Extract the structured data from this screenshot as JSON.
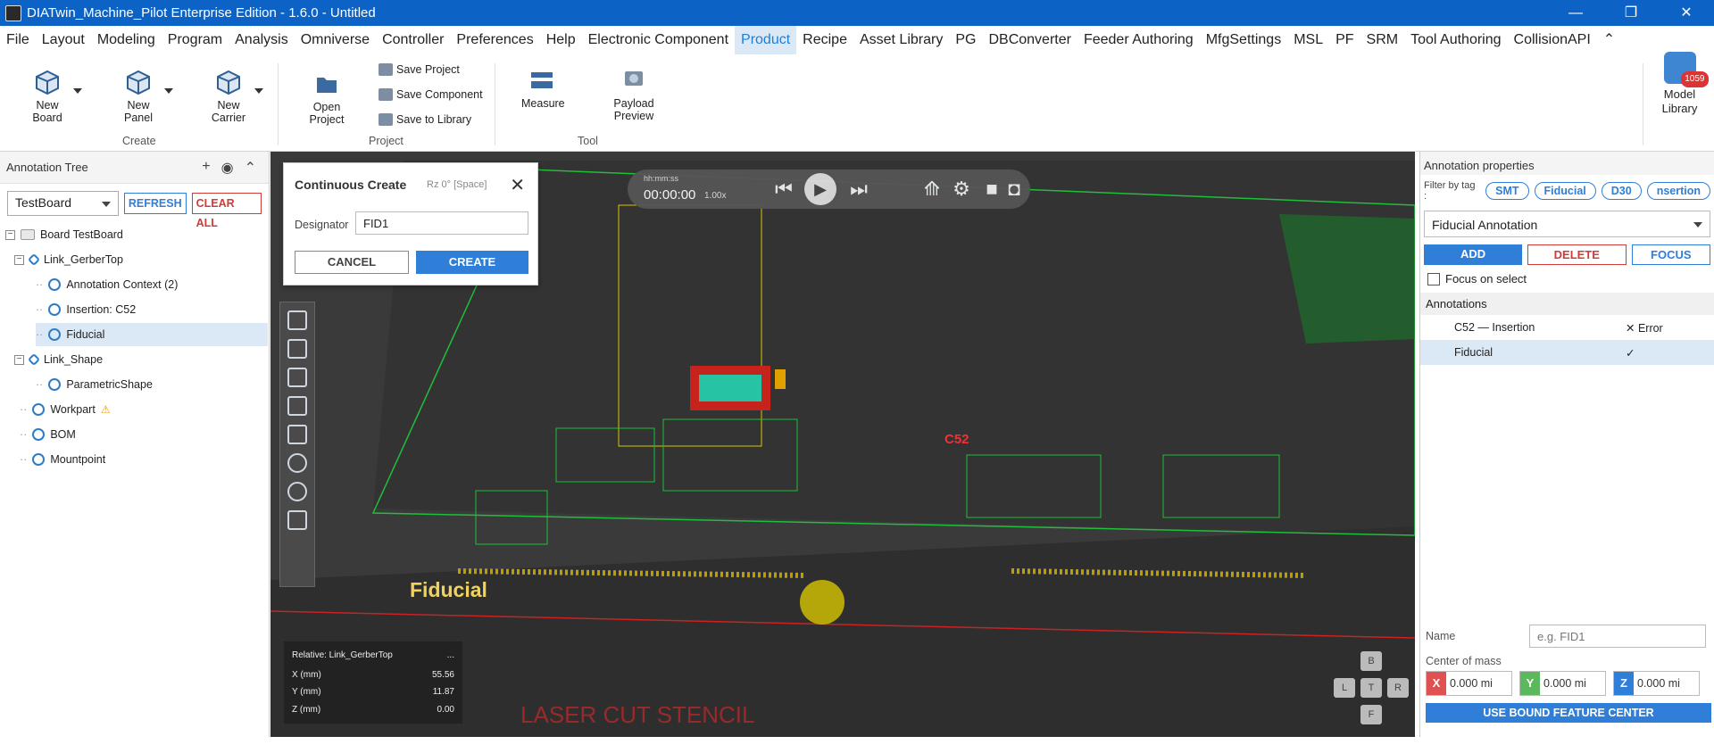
{
  "titlebar": {
    "title": "DIATwin_Machine_Pilot Enterprise Edition - 1.6.0 - Untitled",
    "min": "—",
    "max": "❐",
    "close": "✕"
  },
  "menu": [
    "File",
    "Layout",
    "Modeling",
    "Program",
    "Analysis",
    "Omniverse",
    "Controller",
    "Preferences",
    "Help",
    "Electronic Component",
    "Product",
    "Recipe",
    "Asset Library",
    "PG",
    "DBConverter",
    "Feeder Authoring",
    "MfgSettings",
    "MSL",
    "PF",
    "SRM",
    "Tool Authoring",
    "CollisionAPI"
  ],
  "menu_active": "Product",
  "ribbon": {
    "new_board": "New\nBoard",
    "new_panel": "New\nPanel",
    "new_carrier": "New\nCarrier",
    "group_create": "Create",
    "open_project": "Open\nProject",
    "save_project": "Save Project",
    "save_component": "Save Component",
    "save_library": "Save to Library",
    "group_project": "Project",
    "measure": "Measure",
    "payload_preview": "Payload\nPreview",
    "group_tool": "Tool",
    "model_library": "Model\nLibrary",
    "model_badge": "1059"
  },
  "annotation_tree": {
    "title": "Annotation Tree",
    "board_select": "TestBoard",
    "refresh": "REFRESH",
    "clear_all": "CLEAR ALL",
    "nodes": {
      "board": "Board  TestBoard",
      "link_gerber": "Link_GerberTop",
      "ann_context": "Annotation Context (2)",
      "insertion": "Insertion: C52",
      "fiducial": "Fiducial",
      "link_shape": "Link_Shape",
      "parametric": "ParametricShape",
      "workpart": "Workpart",
      "bom": "BOM",
      "mountpoint": "Mountpoint"
    }
  },
  "dialog": {
    "title": "Continuous Create",
    "subtitle": "Rz 0°  [Space]",
    "designator_label": "Designator",
    "designator_value": "FID1",
    "cancel": "CANCEL",
    "create": "CREATE"
  },
  "player": {
    "hms": "hh:mm:ss",
    "time": "00:00:00",
    "speed": "1.00x"
  },
  "viewport": {
    "fiducial_label": "Fiducial",
    "c52_label": "C52",
    "laser_text": "LASER CUT STENCIL",
    "info": {
      "relative": "Relative: Link_GerberTop",
      "more": "...",
      "x_label": "X (mm)",
      "x": "55.56",
      "y_label": "Y (mm)",
      "y": "11.87",
      "z_label": "Z (mm)",
      "z": "0.00"
    },
    "navcube": {
      "b": "B",
      "l": "L",
      "t": "T",
      "r": "R",
      "f": "F"
    }
  },
  "annotation_props": {
    "title": "Annotation properties",
    "filter_label": "Filter by tag :",
    "tags": [
      "SMT",
      "Fiducial",
      "D30",
      "nsertion"
    ],
    "type_select": "Fiducial Annotation",
    "add": "ADD",
    "delete": "DELETE",
    "focus": "FOCUS",
    "focus_on_select": "Focus on select",
    "annotations_head": "Annotations",
    "rows": [
      {
        "name": "C52 — Insertion",
        "status": "✕ Error"
      },
      {
        "name": "Fiducial",
        "status": "✓"
      }
    ],
    "name_label": "Name",
    "name_placeholder": "e.g. FID1",
    "com_label": "Center of mass",
    "x_val": "0.000 mi",
    "y_val": "0.000 mi",
    "z_val": "0.000 mi",
    "use_bound": "USE BOUND FEATURE CENTER"
  }
}
